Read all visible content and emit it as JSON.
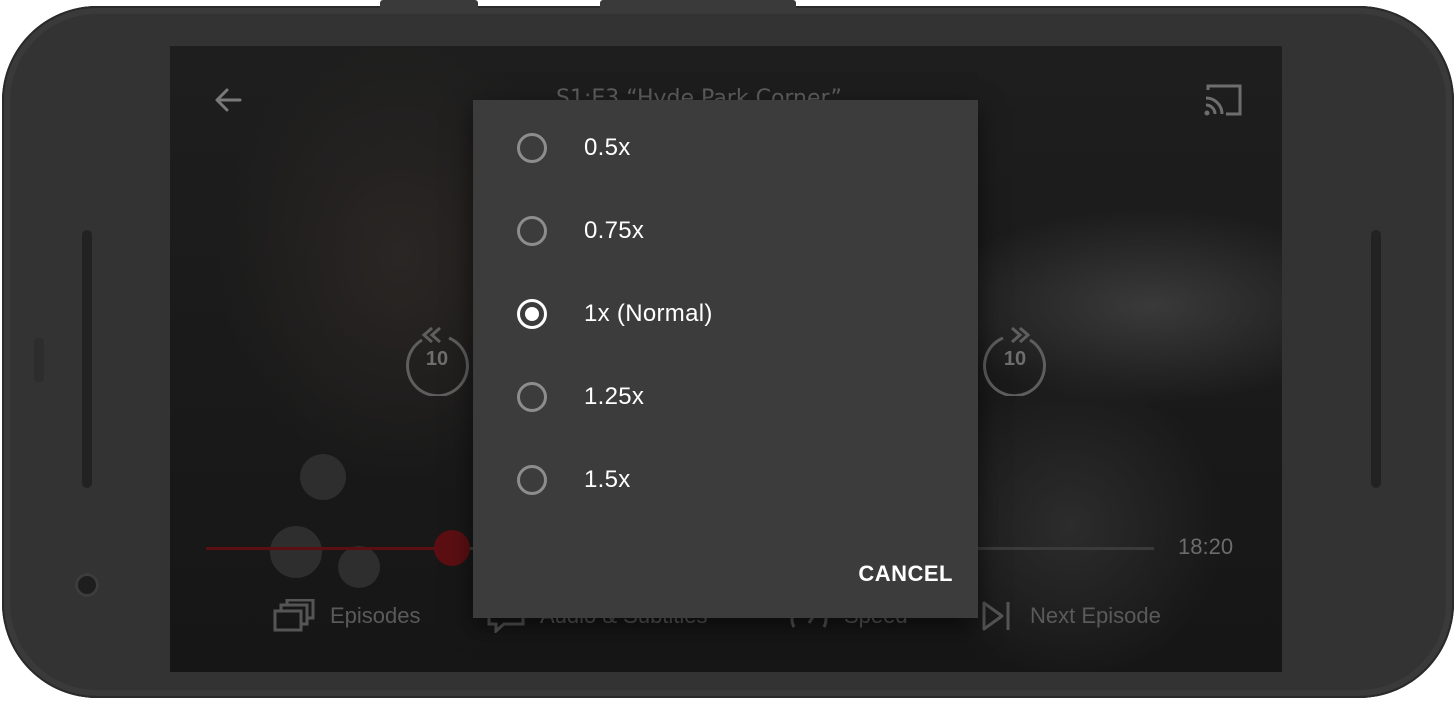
{
  "player": {
    "episode_title": "S1:E3 “Hyde Park Corner”",
    "rewind_seconds": "10",
    "forward_seconds": "10",
    "time_remaining": "18:20",
    "progress_fraction": 0.26,
    "accent_color": "#e50914"
  },
  "bottom_bar": {
    "episodes_label": "Episodes",
    "audio_subtitles_label": "Audio & Subtitles",
    "speed_label": "Speed",
    "next_episode_label": "Next Episode"
  },
  "icons": {
    "back": "back-arrow-icon",
    "cast": "cast-icon",
    "rewind": "rewind-10-icon",
    "forward": "forward-10-icon",
    "episodes": "episodes-icon",
    "audio_subtitles": "subtitles-icon",
    "speed": "speed-icon",
    "next_episode": "next-episode-icon"
  },
  "speed_dialog": {
    "options": [
      {
        "label": "0.5x",
        "selected": false
      },
      {
        "label": "0.75x",
        "selected": false
      },
      {
        "label": "1x (Normal)",
        "selected": true
      },
      {
        "label": "1.25x",
        "selected": false
      },
      {
        "label": "1.5x",
        "selected": false
      }
    ],
    "cancel_label": "CANCEL"
  }
}
